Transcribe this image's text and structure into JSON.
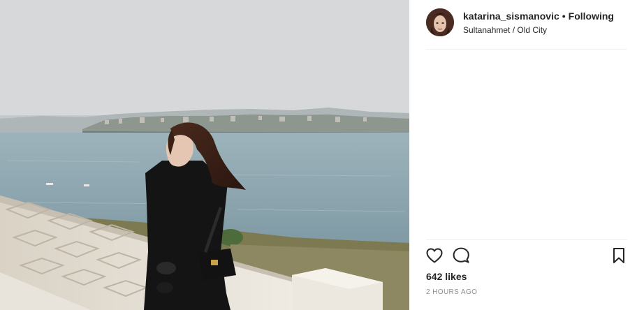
{
  "header": {
    "username": "katarina_sismanovic",
    "separator": "•",
    "follow_status": "Following",
    "location": "Sultanahmet / Old City"
  },
  "actions": {
    "like_icon": "heart-outline-icon",
    "comment_icon": "comment-bubble-icon",
    "save_icon": "bookmark-outline-icon"
  },
  "stats": {
    "likes": "642 likes",
    "timestamp": "2 HOURS AGO"
  },
  "colors": {
    "text": "#262626",
    "muted": "#8e8e8e",
    "divider": "#efefef"
  }
}
